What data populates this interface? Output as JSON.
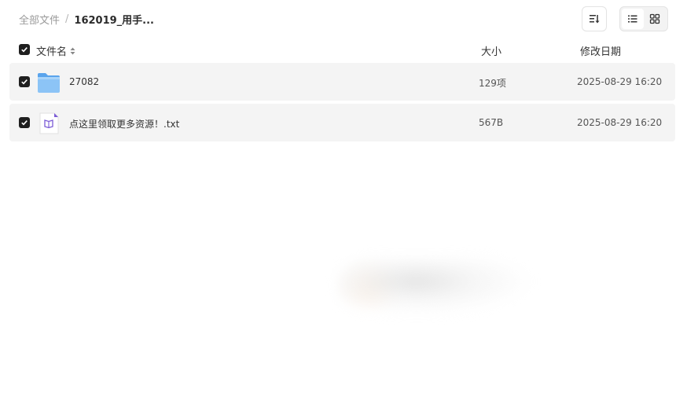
{
  "breadcrumb": {
    "root": "全部文件",
    "separator": "/",
    "current": "162019_用手..."
  },
  "toolbar": {
    "sort_icon": "sort-icon",
    "view_list_icon": "list-view-icon",
    "view_grid_icon": "grid-view-icon",
    "active_view": "list"
  },
  "table": {
    "headers": {
      "name": "文件名",
      "size": "大小",
      "date": "修改日期"
    },
    "rows": [
      {
        "name": "27082",
        "size": "129项",
        "date": "2025-08-29 16:20",
        "icon": "folder-icon",
        "checked": true
      },
      {
        "name": "点这里领取更多资源！.txt",
        "size": "567B",
        "date": "2025-08-29 16:20",
        "icon": "text-file-icon",
        "checked": true
      }
    ]
  },
  "colors": {
    "row_bg": "#f4f4f4",
    "checkbox": "#1f1f1f",
    "folder": "#6fb3f2",
    "file_icon_accent": "#7b5bd6"
  }
}
